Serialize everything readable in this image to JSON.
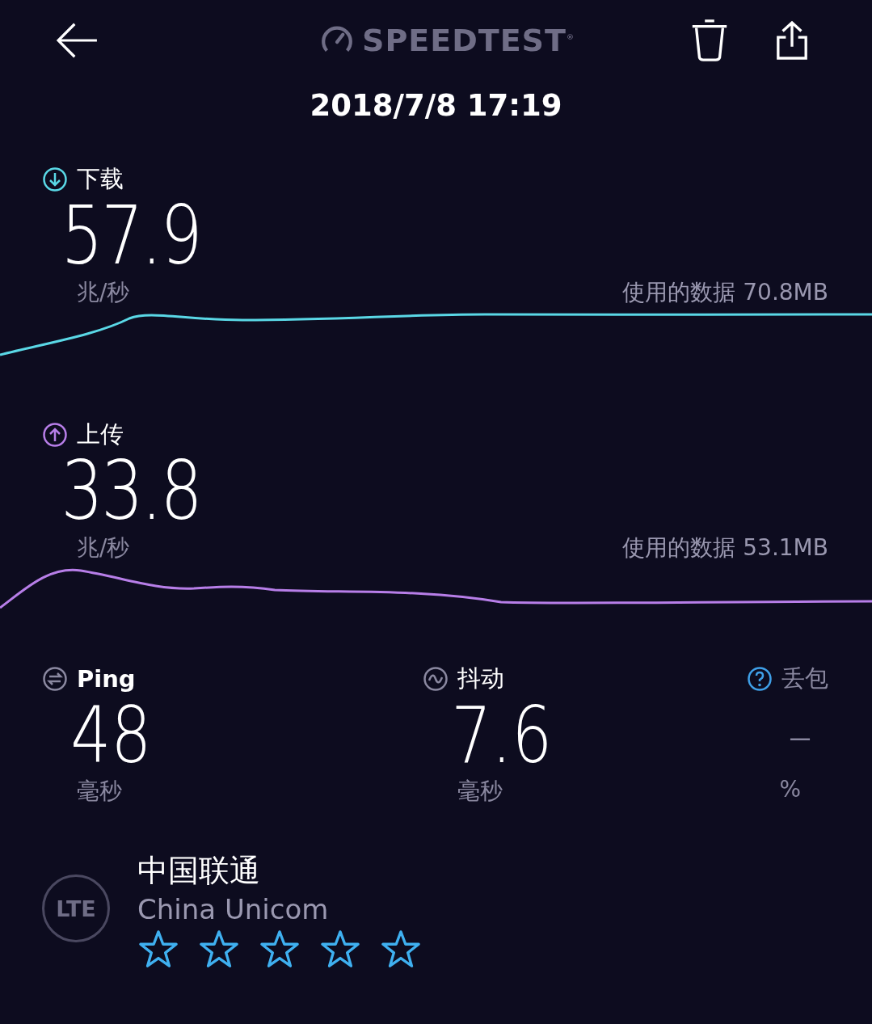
{
  "header": {
    "logo": "SPEEDTEST",
    "registered": "®",
    "date": "2018/7/8 17:19"
  },
  "results": [
    {
      "kind": "download",
      "label": "下载",
      "value": "57.9",
      "unit": "兆/秒",
      "data_used": "使用的数据 70.8MB",
      "color": "#5ad8e6"
    },
    {
      "kind": "upload",
      "label": "上传",
      "value": "33.8",
      "unit": "兆/秒",
      "data_used": "使用的数据 53.1MB",
      "color": "#b77ee8"
    }
  ],
  "stats": [
    {
      "kind": "ping",
      "label": "Ping",
      "value": "48",
      "unit": "毫秒"
    },
    {
      "kind": "jitter",
      "label": "抖动",
      "value": "7.6",
      "unit": "毫秒"
    },
    {
      "kind": "loss",
      "label": "丢包",
      "value": "–",
      "unit": "%"
    }
  ],
  "carrier": {
    "badge": "LTE",
    "name": "中国联通",
    "name_en": "China Unicom",
    "stars": 0
  }
}
